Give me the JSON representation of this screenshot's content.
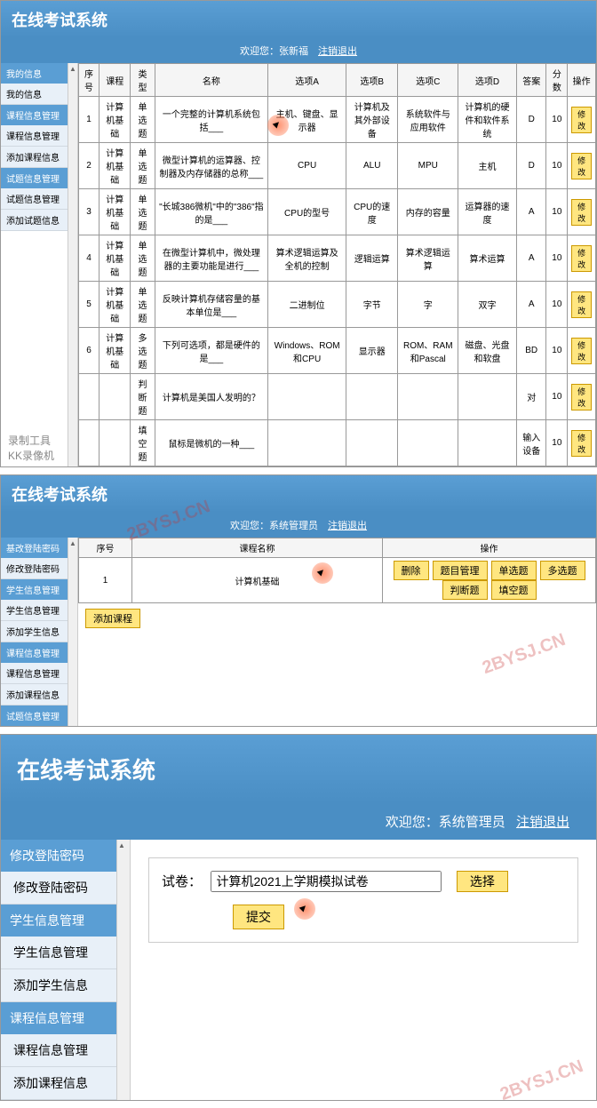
{
  "app_title": "在线考试系统",
  "f1": {
    "welcome": "欢迎您：张新福",
    "logout": "注销退出",
    "side": {
      "g1": "我的信息",
      "i1": "我的信息",
      "g2": "课程信息管理",
      "i2": "课程信息管理",
      "i3": "添加课程信息",
      "g3": "试题信息管理",
      "i4": "试题信息管理",
      "i5": "添加试题信息"
    },
    "th": [
      "序号",
      "课程",
      "类型",
      "名称",
      "选项A",
      "选项B",
      "选项C",
      "选项D",
      "答案",
      "分数",
      "操作"
    ],
    "rows": [
      [
        "1",
        "计算机基础",
        "单选题",
        "一个完整的计算机系统包括___",
        "主机、键盘、显示器",
        "计算机及其外部设备",
        "系统软件与应用软件",
        "计算机的硬件和软件系统",
        "D",
        "10"
      ],
      [
        "2",
        "计算机基础",
        "单选题",
        "微型计算机的运算器、控制器及内存储器的总称___",
        "CPU",
        "ALU",
        "MPU",
        "主机",
        "D",
        "10"
      ],
      [
        "3",
        "计算机基础",
        "单选题",
        "\"长城386微机\"中的\"386\"指的是___",
        "CPU的型号",
        "CPU的速度",
        "内存的容量",
        "运算器的速度",
        "A",
        "10"
      ],
      [
        "4",
        "计算机基础",
        "单选题",
        "在微型计算机中，微处理器的主要功能是进行___",
        "算术逻辑运算及全机的控制",
        "逻辑运算",
        "算术逻辑运算",
        "算术运算",
        "A",
        "10"
      ],
      [
        "5",
        "计算机基础",
        "单选题",
        "反映计算机存储容量的基本单位是___",
        "二进制位",
        "字节",
        "字",
        "双字",
        "A",
        "10"
      ],
      [
        "6",
        "计算机基础",
        "多选题",
        "下列可选项，都是硬件的是___",
        "Windows、ROM和CPU",
        "显示器",
        "ROM、RAM和Pascal",
        "磁盘、光盘和软盘",
        "BD",
        "10"
      ],
      [
        "",
        "",
        "判断题",
        "计算机是美国人发明的？",
        "",
        "",
        "",
        "",
        "对",
        "10"
      ],
      [
        "",
        "",
        "填空题",
        "鼠标是微机的一种___",
        "",
        "",
        "",
        "",
        "输入设备",
        "10"
      ]
    ],
    "op": "修改",
    "rec1": "录制工具",
    "rec2": "KK录像机"
  },
  "f2": {
    "welcome": "欢迎您：系统管理员",
    "logout": "注销退出",
    "side": {
      "g1": "基改登陆密码",
      "i1": "修改登陆密码",
      "g2": "学生信息管理",
      "i2": "学生信息管理",
      "i3": "添加学生信息",
      "g3": "课程信息管理",
      "i4": "课程信息管理",
      "i5": "添加课程信息",
      "g4": "试题信息管理"
    },
    "th": [
      "序号",
      "课程名称",
      "操作"
    ],
    "row": [
      "1",
      "计算机基础"
    ],
    "ops": [
      "删除",
      "题目管理",
      "单选题",
      "多选题",
      "判断题",
      "填空题"
    ],
    "add": "添加课程"
  },
  "f3": {
    "welcome": "欢迎您：系统管理员",
    "logout": "注销退出",
    "side": {
      "g1": "修改登陆密码",
      "i1": "修改登陆密码",
      "g2": "学生信息管理",
      "i2": "学生信息管理",
      "i3": "添加学生信息",
      "g3": "课程信息管理",
      "i4": "课程信息管理",
      "i5": "添加课程信息"
    },
    "form": {
      "label": "试卷：",
      "value": "计算机2021上学期模拟试卷",
      "select": "选择",
      "submit": "提交"
    }
  },
  "wm": "2BYSJ.CN"
}
